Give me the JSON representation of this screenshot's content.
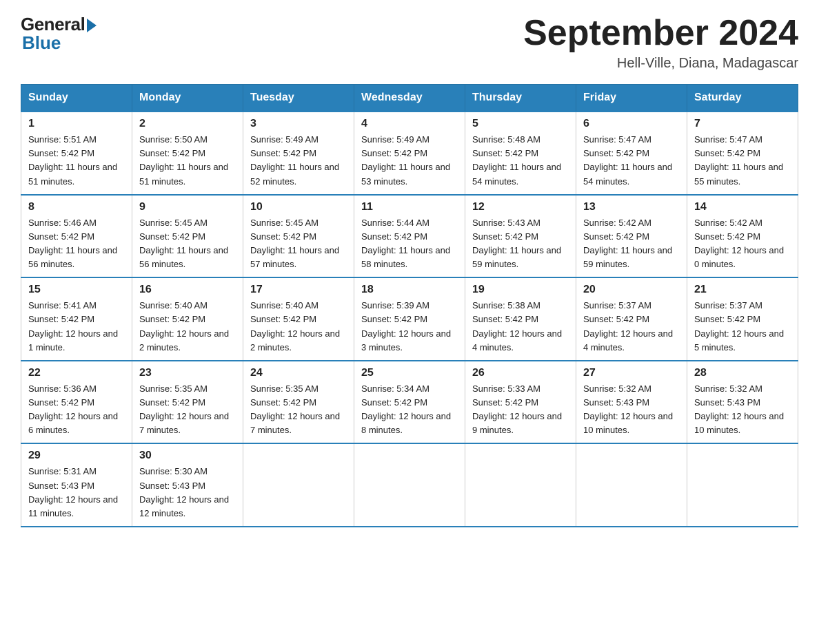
{
  "header": {
    "logo_general": "General",
    "logo_blue": "Blue",
    "title": "September 2024",
    "location": "Hell-Ville, Diana, Madagascar"
  },
  "days_of_week": [
    "Sunday",
    "Monday",
    "Tuesday",
    "Wednesday",
    "Thursday",
    "Friday",
    "Saturday"
  ],
  "weeks": [
    [
      {
        "day": "1",
        "sunrise": "5:51 AM",
        "sunset": "5:42 PM",
        "daylight": "11 hours and 51 minutes."
      },
      {
        "day": "2",
        "sunrise": "5:50 AM",
        "sunset": "5:42 PM",
        "daylight": "11 hours and 51 minutes."
      },
      {
        "day": "3",
        "sunrise": "5:49 AM",
        "sunset": "5:42 PM",
        "daylight": "11 hours and 52 minutes."
      },
      {
        "day": "4",
        "sunrise": "5:49 AM",
        "sunset": "5:42 PM",
        "daylight": "11 hours and 53 minutes."
      },
      {
        "day": "5",
        "sunrise": "5:48 AM",
        "sunset": "5:42 PM",
        "daylight": "11 hours and 54 minutes."
      },
      {
        "day": "6",
        "sunrise": "5:47 AM",
        "sunset": "5:42 PM",
        "daylight": "11 hours and 54 minutes."
      },
      {
        "day": "7",
        "sunrise": "5:47 AM",
        "sunset": "5:42 PM",
        "daylight": "11 hours and 55 minutes."
      }
    ],
    [
      {
        "day": "8",
        "sunrise": "5:46 AM",
        "sunset": "5:42 PM",
        "daylight": "11 hours and 56 minutes."
      },
      {
        "day": "9",
        "sunrise": "5:45 AM",
        "sunset": "5:42 PM",
        "daylight": "11 hours and 56 minutes."
      },
      {
        "day": "10",
        "sunrise": "5:45 AM",
        "sunset": "5:42 PM",
        "daylight": "11 hours and 57 minutes."
      },
      {
        "day": "11",
        "sunrise": "5:44 AM",
        "sunset": "5:42 PM",
        "daylight": "11 hours and 58 minutes."
      },
      {
        "day": "12",
        "sunrise": "5:43 AM",
        "sunset": "5:42 PM",
        "daylight": "11 hours and 59 minutes."
      },
      {
        "day": "13",
        "sunrise": "5:42 AM",
        "sunset": "5:42 PM",
        "daylight": "11 hours and 59 minutes."
      },
      {
        "day": "14",
        "sunrise": "5:42 AM",
        "sunset": "5:42 PM",
        "daylight": "12 hours and 0 minutes."
      }
    ],
    [
      {
        "day": "15",
        "sunrise": "5:41 AM",
        "sunset": "5:42 PM",
        "daylight": "12 hours and 1 minute."
      },
      {
        "day": "16",
        "sunrise": "5:40 AM",
        "sunset": "5:42 PM",
        "daylight": "12 hours and 2 minutes."
      },
      {
        "day": "17",
        "sunrise": "5:40 AM",
        "sunset": "5:42 PM",
        "daylight": "12 hours and 2 minutes."
      },
      {
        "day": "18",
        "sunrise": "5:39 AM",
        "sunset": "5:42 PM",
        "daylight": "12 hours and 3 minutes."
      },
      {
        "day": "19",
        "sunrise": "5:38 AM",
        "sunset": "5:42 PM",
        "daylight": "12 hours and 4 minutes."
      },
      {
        "day": "20",
        "sunrise": "5:37 AM",
        "sunset": "5:42 PM",
        "daylight": "12 hours and 4 minutes."
      },
      {
        "day": "21",
        "sunrise": "5:37 AM",
        "sunset": "5:42 PM",
        "daylight": "12 hours and 5 minutes."
      }
    ],
    [
      {
        "day": "22",
        "sunrise": "5:36 AM",
        "sunset": "5:42 PM",
        "daylight": "12 hours and 6 minutes."
      },
      {
        "day": "23",
        "sunrise": "5:35 AM",
        "sunset": "5:42 PM",
        "daylight": "12 hours and 7 minutes."
      },
      {
        "day": "24",
        "sunrise": "5:35 AM",
        "sunset": "5:42 PM",
        "daylight": "12 hours and 7 minutes."
      },
      {
        "day": "25",
        "sunrise": "5:34 AM",
        "sunset": "5:42 PM",
        "daylight": "12 hours and 8 minutes."
      },
      {
        "day": "26",
        "sunrise": "5:33 AM",
        "sunset": "5:42 PM",
        "daylight": "12 hours and 9 minutes."
      },
      {
        "day": "27",
        "sunrise": "5:32 AM",
        "sunset": "5:43 PM",
        "daylight": "12 hours and 10 minutes."
      },
      {
        "day": "28",
        "sunrise": "5:32 AM",
        "sunset": "5:43 PM",
        "daylight": "12 hours and 10 minutes."
      }
    ],
    [
      {
        "day": "29",
        "sunrise": "5:31 AM",
        "sunset": "5:43 PM",
        "daylight": "12 hours and 11 minutes."
      },
      {
        "day": "30",
        "sunrise": "5:30 AM",
        "sunset": "5:43 PM",
        "daylight": "12 hours and 12 minutes."
      },
      null,
      null,
      null,
      null,
      null
    ]
  ]
}
